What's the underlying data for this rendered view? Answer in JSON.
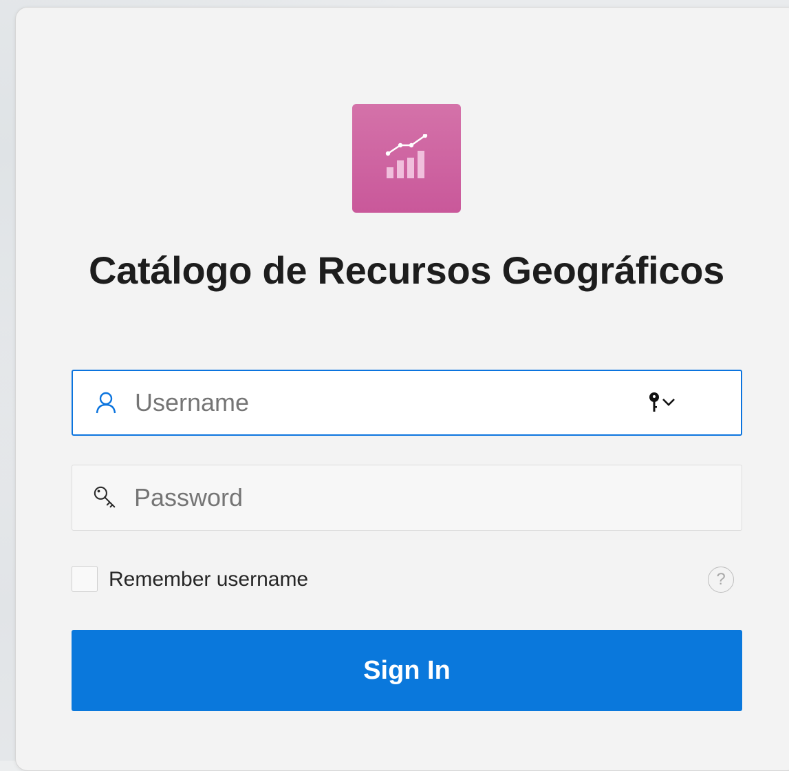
{
  "app": {
    "title": "Catálogo de Recursos Geográficos",
    "icon": "chart-bars-trend-icon",
    "icon_color": "#cf65a2"
  },
  "form": {
    "username": {
      "placeholder": "Username",
      "value": "",
      "icon": "user-icon",
      "accessory_icon": "keychain-autofill-icon",
      "focused": true
    },
    "password": {
      "placeholder": "Password",
      "value": "",
      "icon": "key-icon"
    },
    "remember": {
      "label": "Remember username",
      "checked": false
    },
    "help": {
      "symbol": "?"
    },
    "submit_label": "Sign In"
  },
  "colors": {
    "accent": "#0a78dc",
    "focus_border": "#0b74de",
    "card_background": "#f3f3f3"
  }
}
